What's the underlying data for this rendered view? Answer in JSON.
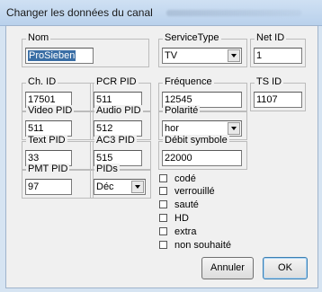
{
  "window": {
    "title": "Changer les données du canal"
  },
  "groups": {
    "nom": {
      "label": "Nom",
      "value": "ProSieben"
    },
    "service_type": {
      "label": "ServiceType",
      "value": "TV"
    },
    "net_id": {
      "label": "Net ID",
      "value": "1"
    },
    "ch_id": {
      "label": "Ch. ID",
      "value": "17501"
    },
    "pcr_pid": {
      "label": "PCR PID",
      "value": "511"
    },
    "frequence": {
      "label": "Fréquence",
      "value": "12545"
    },
    "ts_id": {
      "label": "TS ID",
      "value": "1107"
    },
    "video_pid": {
      "label": "Video PID",
      "value": "511"
    },
    "audio_pid": {
      "label": "Audio PID",
      "value": "512"
    },
    "polarite": {
      "label": "Polarité",
      "value": "hor"
    },
    "text_pid": {
      "label": "Text PID",
      "value": "33"
    },
    "ac3_pid": {
      "label": "AC3 PID",
      "value": "515"
    },
    "debit_symbole": {
      "label": "Débit symbole",
      "value": "22000"
    },
    "pmt_pid": {
      "label": "PMT PID",
      "value": "97"
    },
    "pids": {
      "label": "PIDs",
      "value": "Déc"
    }
  },
  "checkboxes": [
    {
      "label": "codé",
      "checked": false
    },
    {
      "label": "verrouillé",
      "checked": false
    },
    {
      "label": "sauté",
      "checked": false
    },
    {
      "label": "HD",
      "checked": false
    },
    {
      "label": "extra",
      "checked": false
    },
    {
      "label": "non souhaité",
      "checked": false
    }
  ],
  "buttons": {
    "cancel": "Annuler",
    "ok": "OK"
  }
}
